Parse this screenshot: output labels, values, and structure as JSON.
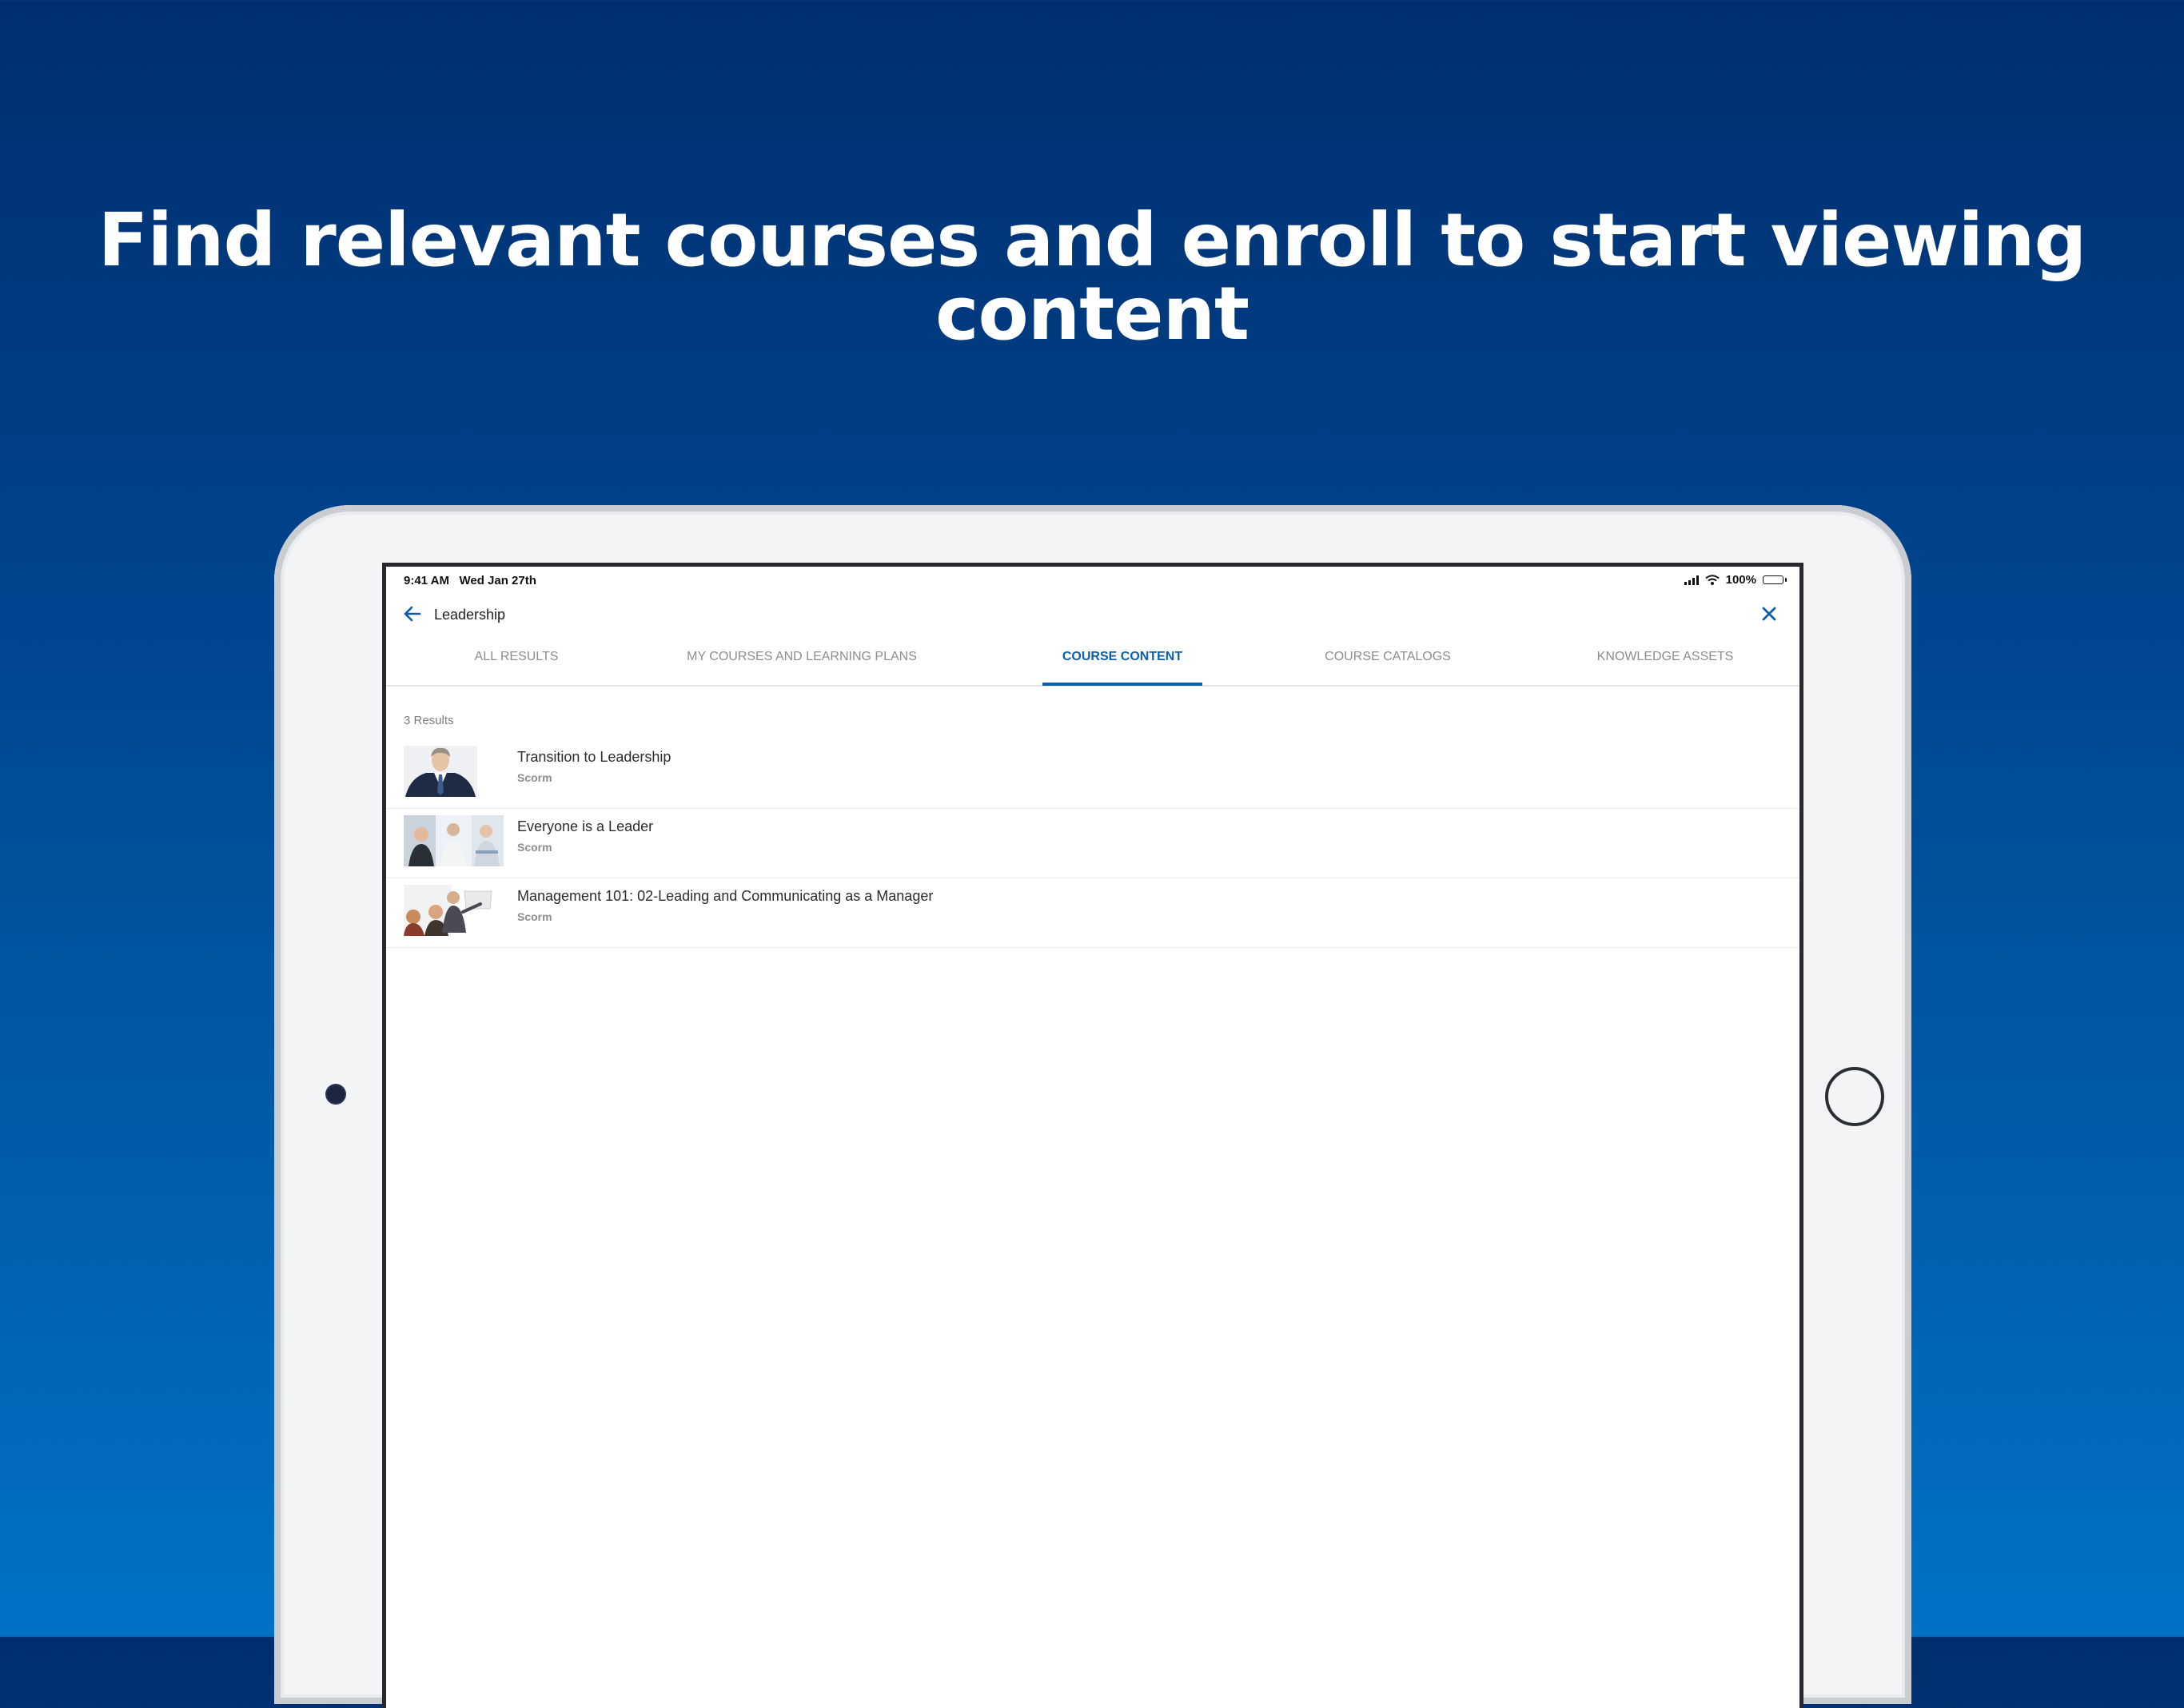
{
  "headline": "Find relevant courses and enroll to start viewing content",
  "status_bar": {
    "time_date": "9:41 AM   Wed Jan 27th",
    "battery": "100%",
    "icons": [
      "cellular-signal-icon",
      "wifi-icon",
      "battery-icon"
    ]
  },
  "search": {
    "query": "Leadership",
    "back_icon": "arrow-left-icon",
    "close_icon": "close-icon"
  },
  "tabs": [
    {
      "label": "ALL RESULTS",
      "active": false
    },
    {
      "label": "MY COURSES AND LEARNING PLANS",
      "active": false
    },
    {
      "label": "COURSE CONTENT",
      "active": true
    },
    {
      "label": "COURSE CATALOGS",
      "active": false
    },
    {
      "label": "KNOWLEDGE ASSETS",
      "active": false
    }
  ],
  "results_count": "3 Results",
  "results": [
    {
      "title": "Transition to Leadership",
      "type": "Scorm"
    },
    {
      "title": "Everyone is a Leader",
      "type": "Scorm"
    },
    {
      "title": "Management 101: 02-Leading and Communicating as a Manager",
      "type": "Scorm"
    }
  ],
  "colors": {
    "accent": "#0a5fa8",
    "background_top": "#002e6e",
    "background_bottom": "#0072c6"
  }
}
